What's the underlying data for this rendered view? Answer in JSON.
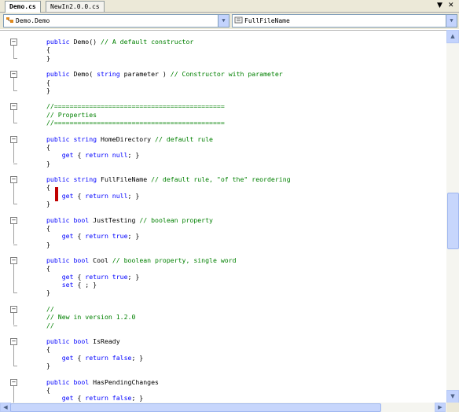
{
  "tabs": [
    {
      "label": "Demo.cs",
      "active": true
    },
    {
      "label": "NewIn2.0.0.cs",
      "active": false
    }
  ],
  "tab_controls": {
    "dropdown": "▼",
    "close": "✕"
  },
  "nav": {
    "type_combo": "Demo.Demo",
    "member_combo": "FullFileName"
  },
  "code": [
    [
      [
        "kw",
        "public "
      ],
      [
        "tx",
        "Demo() "
      ],
      [
        "cm",
        "// A default constructor"
      ]
    ],
    [
      [
        "tx",
        "{"
      ]
    ],
    [
      [
        "tx",
        "}"
      ]
    ],
    [],
    [
      [
        "kw",
        "public "
      ],
      [
        "tx",
        "Demo( "
      ],
      [
        "kw",
        "string "
      ],
      [
        "tx",
        "parameter ) "
      ],
      [
        "cm",
        "// Constructor with parameter"
      ]
    ],
    [
      [
        "tx",
        "{"
      ]
    ],
    [
      [
        "tx",
        "}"
      ]
    ],
    [],
    [
      [
        "cm",
        "//============================================"
      ]
    ],
    [
      [
        "cm",
        "// Properties"
      ]
    ],
    [
      [
        "cm",
        "//============================================"
      ]
    ],
    [],
    [
      [
        "kw",
        "public string "
      ],
      [
        "tx",
        "HomeDirectory "
      ],
      [
        "cm",
        "// default rule"
      ]
    ],
    [
      [
        "tx",
        "{"
      ]
    ],
    [
      [
        "tx",
        "    "
      ],
      [
        "kw",
        "get "
      ],
      [
        "tx",
        "{ "
      ],
      [
        "kw",
        "return null"
      ],
      [
        "tx",
        "; }"
      ]
    ],
    [
      [
        "tx",
        "}"
      ]
    ],
    [],
    [
      [
        "kw",
        "public string "
      ],
      [
        "tx",
        "FullFileName "
      ],
      [
        "cm",
        "// default rule, \"of the\" reordering"
      ]
    ],
    [
      [
        "tx",
        "{"
      ]
    ],
    [
      [
        "tx",
        "    "
      ],
      [
        "kw",
        "get "
      ],
      [
        "tx",
        "{ "
      ],
      [
        "kw",
        "return null"
      ],
      [
        "tx",
        "; }"
      ]
    ],
    [
      [
        "tx",
        "}"
      ]
    ],
    [],
    [
      [
        "kw",
        "public bool "
      ],
      [
        "tx",
        "JustTesting "
      ],
      [
        "cm",
        "// boolean property"
      ]
    ],
    [
      [
        "tx",
        "{"
      ]
    ],
    [
      [
        "tx",
        "    "
      ],
      [
        "kw",
        "get "
      ],
      [
        "tx",
        "{ "
      ],
      [
        "kw",
        "return true"
      ],
      [
        "tx",
        "; }"
      ]
    ],
    [
      [
        "tx",
        "}"
      ]
    ],
    [],
    [
      [
        "kw",
        "public bool "
      ],
      [
        "tx",
        "Cool "
      ],
      [
        "cm",
        "// boolean property, single word"
      ]
    ],
    [
      [
        "tx",
        "{"
      ]
    ],
    [
      [
        "tx",
        "    "
      ],
      [
        "kw",
        "get "
      ],
      [
        "tx",
        "{ "
      ],
      [
        "kw",
        "return true"
      ],
      [
        "tx",
        "; }"
      ]
    ],
    [
      [
        "tx",
        "    "
      ],
      [
        "kw",
        "set "
      ],
      [
        "tx",
        "{ ; }"
      ]
    ],
    [
      [
        "tx",
        "}"
      ]
    ],
    [],
    [
      [
        "cm",
        "//"
      ]
    ],
    [
      [
        "cm",
        "// New in version 1.2.0"
      ]
    ],
    [
      [
        "cm",
        "//"
      ]
    ],
    [],
    [
      [
        "kw",
        "public bool "
      ],
      [
        "tx",
        "IsReady"
      ]
    ],
    [
      [
        "tx",
        "{"
      ]
    ],
    [
      [
        "tx",
        "    "
      ],
      [
        "kw",
        "get "
      ],
      [
        "tx",
        "{ "
      ],
      [
        "kw",
        "return false"
      ],
      [
        "tx",
        "; }"
      ]
    ],
    [
      [
        "tx",
        "}"
      ]
    ],
    [],
    [
      [
        "kw",
        "public bool "
      ],
      [
        "tx",
        "HasPendingChanges"
      ]
    ],
    [
      [
        "tx",
        "{"
      ]
    ],
    [
      [
        "tx",
        "    "
      ],
      [
        "kw",
        "get "
      ],
      [
        "tx",
        "{ "
      ],
      [
        "kw",
        "return false"
      ],
      [
        "tx",
        "; }"
      ]
    ],
    [
      [
        "tx",
        "}"
      ]
    ]
  ],
  "outline_lines": [
    0,
    4,
    8,
    12,
    17,
    22,
    27,
    33,
    37,
    42
  ],
  "colors": {
    "keyword": "#0000ff",
    "comment": "#008000",
    "text": "#000000",
    "breakpoint": "#c00000"
  },
  "scrollbar": {
    "up": "▲",
    "down": "▼",
    "left": "◀",
    "right": "▶"
  }
}
